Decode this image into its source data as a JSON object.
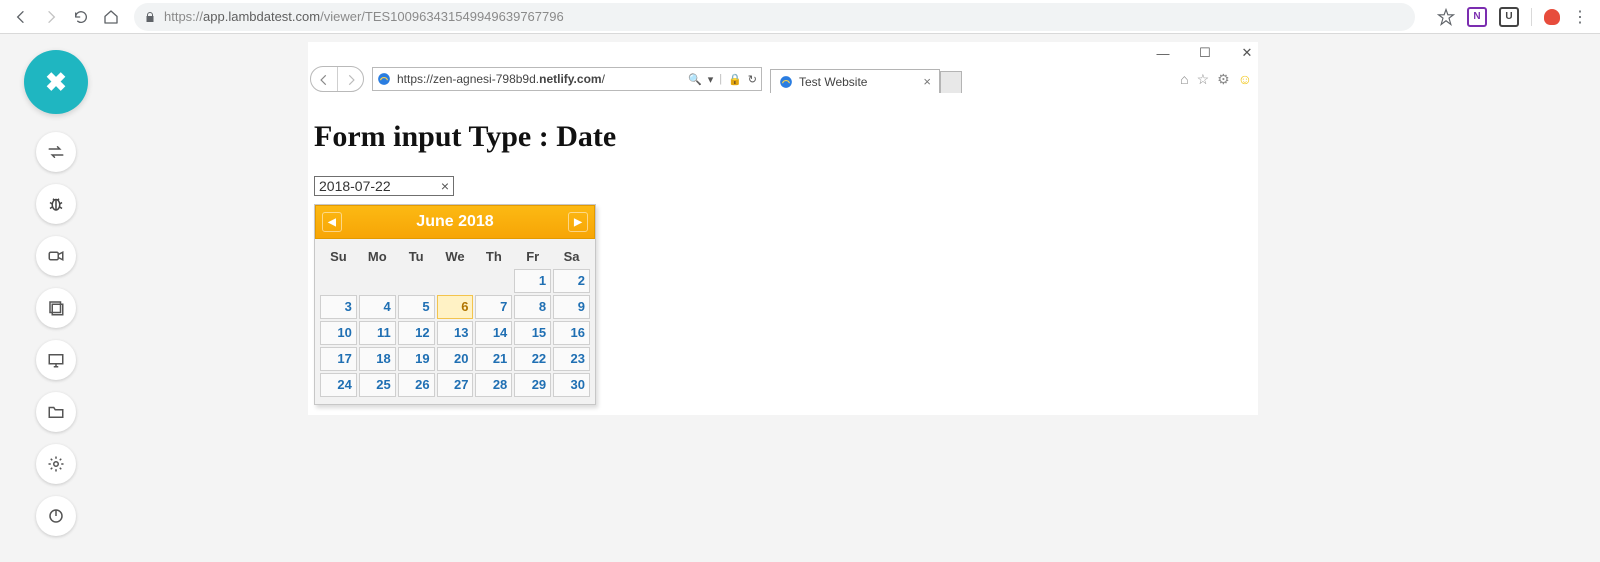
{
  "chrome": {
    "url_proto": "https://",
    "url_domain": "app.lambdatest.com",
    "url_path": "/viewer/TES100963431549949639767796",
    "ext_n_label": "N",
    "ext_u_label": "U",
    "kebab": "⋮"
  },
  "sidebar": {
    "close_glyph": "✖"
  },
  "ie": {
    "win_min": "—",
    "win_max": "☐",
    "win_close": "✕",
    "addr_url_pre": "https://zen-agnesi-798b9d.",
    "addr_url_bold": "netlify.com",
    "addr_url_post": "/",
    "addr_search_glyph": "🔍",
    "addr_search_dd": "▾",
    "addr_lock": "🔒",
    "addr_refresh": "↻",
    "tab_title": "Test Website",
    "tab_x": "×",
    "page_tools": {
      "home": "⌂",
      "star": "☆",
      "gear": "⚙",
      "smile": "☺"
    }
  },
  "page": {
    "heading": "Form input Type : Date",
    "date_value": "2018-07-22",
    "date_clear": "×"
  },
  "datepicker": {
    "month_label": "June 2018",
    "prev": "◀",
    "next": "▶",
    "dow": [
      "Su",
      "Mo",
      "Tu",
      "We",
      "Th",
      "Fr",
      "Sa"
    ],
    "today": 6,
    "weeks": [
      [
        null,
        null,
        null,
        null,
        null,
        1,
        2
      ],
      [
        3,
        4,
        5,
        6,
        7,
        8,
        9
      ],
      [
        10,
        11,
        12,
        13,
        14,
        15,
        16
      ],
      [
        17,
        18,
        19,
        20,
        21,
        22,
        23
      ],
      [
        24,
        25,
        26,
        27,
        28,
        29,
        30
      ]
    ]
  }
}
